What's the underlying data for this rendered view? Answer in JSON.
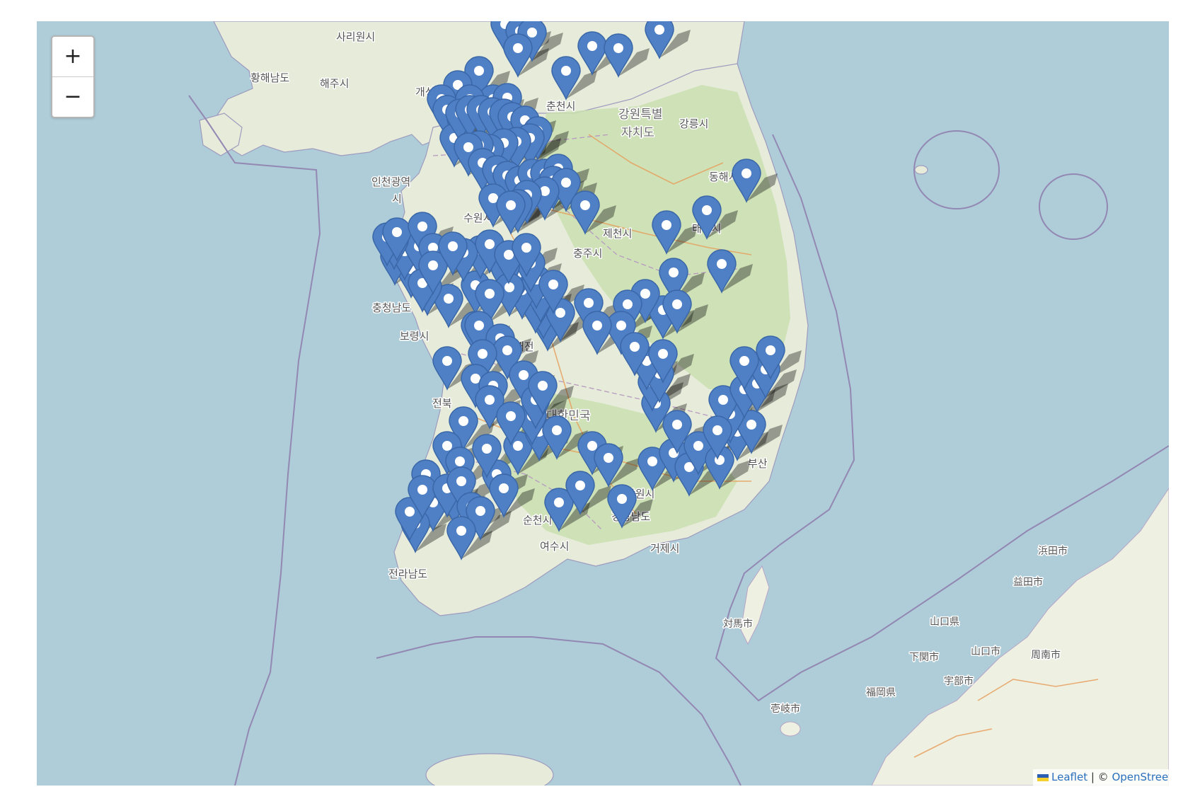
{
  "map": {
    "labels": [
      {
        "id": "sariwon",
        "text": "사리원시"
      },
      {
        "id": "hwanghae-south",
        "text": "황해남도"
      },
      {
        "id": "haeju",
        "text": "해주시"
      },
      {
        "id": "kaesong",
        "text": "개성시"
      },
      {
        "id": "chuncheon",
        "text": "춘천시"
      },
      {
        "id": "gangwon-1",
        "text": "강원특별"
      },
      {
        "id": "gangwon-2",
        "text": "자치도"
      },
      {
        "id": "gangneung",
        "text": "강릉시"
      },
      {
        "id": "donghae",
        "text": "동해시"
      },
      {
        "id": "incheon-1",
        "text": "인천광역"
      },
      {
        "id": "incheon-2",
        "text": "시"
      },
      {
        "id": "suwon",
        "text": "수원시"
      },
      {
        "id": "jecheon",
        "text": "제천시"
      },
      {
        "id": "chungju",
        "text": "충주시"
      },
      {
        "id": "taebaek",
        "text": "태백시"
      },
      {
        "id": "chungnam",
        "text": "충청남도"
      },
      {
        "id": "boryeong",
        "text": "보령시"
      },
      {
        "id": "daejeon",
        "text": "대전"
      },
      {
        "id": "korea",
        "text": "대한민국"
      },
      {
        "id": "jeonbuk",
        "text": "전북"
      },
      {
        "id": "changwon",
        "text": "창원시"
      },
      {
        "id": "gyeongnam",
        "text": "경상남도"
      },
      {
        "id": "busan",
        "text": "부산"
      },
      {
        "id": "suncheon",
        "text": "순천시"
      },
      {
        "id": "yeosu",
        "text": "여수시"
      },
      {
        "id": "geoje",
        "text": "거제시"
      },
      {
        "id": "jeonnam",
        "text": "전라남도"
      },
      {
        "id": "tsushima",
        "text": "対馬市"
      },
      {
        "id": "iki",
        "text": "壱岐市"
      },
      {
        "id": "hamada",
        "text": "浜田市"
      },
      {
        "id": "masuda",
        "text": "益田市"
      },
      {
        "id": "yamaguchi",
        "text": "山口県"
      },
      {
        "id": "yamaguchi-city",
        "text": "山口市"
      },
      {
        "id": "shunan",
        "text": "周南市"
      },
      {
        "id": "shimonoseki",
        "text": "下関市"
      },
      {
        "id": "ube",
        "text": "宇部市"
      },
      {
        "id": "fukuoka",
        "text": "福岡県"
      }
    ],
    "marker_color": "#4f7fc4",
    "marker_count": 152
  },
  "zoom": {
    "in_label": "+",
    "out_label": "−"
  },
  "attribution": {
    "leaflet": "Leaflet",
    "separator": " | © ",
    "osm": "OpenStreetMap"
  }
}
